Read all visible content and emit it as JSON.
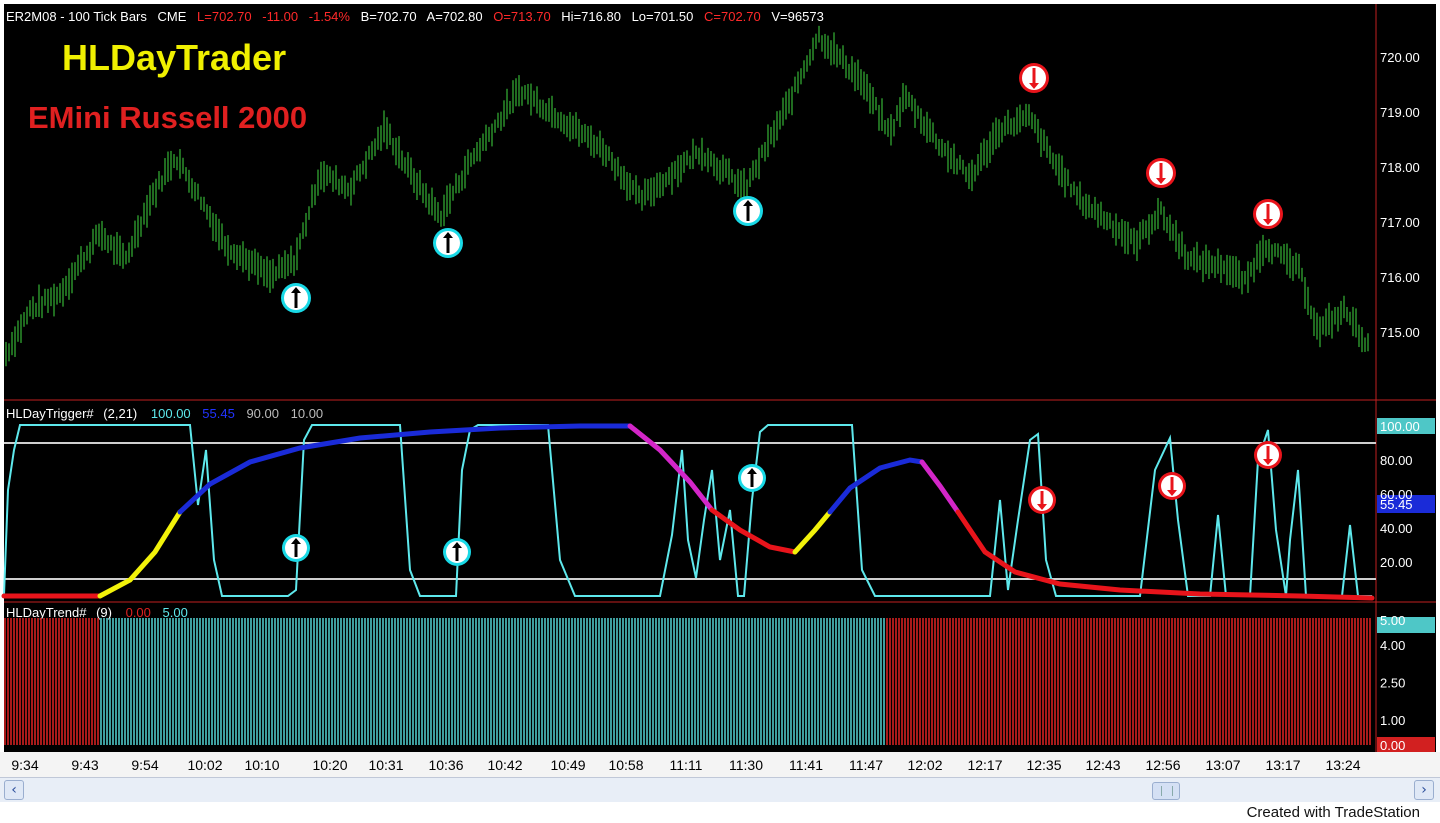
{
  "header": {
    "symbol": "ER2M08 - 100 Tick Bars",
    "exchange": "CME",
    "last": "L=702.70",
    "net_change": "-11.00",
    "pct_change": "-1.54%",
    "bid": "B=702.70",
    "ask": "A=702.80",
    "open": "O=713.70",
    "high": "Hi=716.80",
    "low": "Lo=701.50",
    "close": "C=702.70",
    "volume": "V=96573"
  },
  "titles": {
    "main": "HLDayTrader",
    "sub": "EMini Russell 2000"
  },
  "price_axis": {
    "labels": [
      "720.00",
      "719.00",
      "718.00",
      "717.00",
      "716.00",
      "715.00"
    ],
    "values": [
      720,
      719,
      718,
      717,
      716,
      715
    ]
  },
  "trigger_panel": {
    "name": "HLDayTrigger#",
    "params": "(2,21)",
    "v1": "100.00",
    "v2": "55.45",
    "v3": "90.00",
    "v4": "10.00",
    "axis_labels": [
      "100.00",
      "80.00",
      "60.00",
      "40.00",
      "20.00"
    ],
    "axis_values": [
      100,
      80,
      60,
      40,
      20
    ],
    "current_tag": "55.45"
  },
  "trend_panel": {
    "name": "HLDayTrend#",
    "params": "(9)",
    "v1": "0.00",
    "v2": "5.00",
    "axis_labels": [
      "5.00",
      "4.00",
      "2.50",
      "1.00",
      "0.00"
    ],
    "axis_values": [
      5,
      4,
      2.5,
      1,
      0
    ]
  },
  "time_axis": [
    "9:34",
    "9:43",
    "9:54",
    "10:02",
    "10:10",
    "10:20",
    "10:31",
    "10:36",
    "10:42",
    "10:49",
    "10:58",
    "11:11",
    "11:30",
    "11:41",
    "11:47",
    "12:02",
    "12:17",
    "12:35",
    "12:43",
    "12:56",
    "13:07",
    "13:17",
    "13:24"
  ],
  "signals": {
    "buy_icon": "up-arrow-circle-icon",
    "sell_icon": "down-arrow-circle-icon",
    "buy_color": "#19d9e6",
    "sell_color": "#e8141b"
  },
  "colors": {
    "background": "#000000",
    "bars": "#2e9a2e",
    "trigger_line": "#5ee8ec",
    "trend_up": "#4ec7c7",
    "trend_down": "#d22020",
    "title_main": "#f0f000",
    "title_sub": "#e02020"
  },
  "scrollbar": {
    "left_icon": "chevron-left-icon",
    "right_icon": "chevron-right-icon",
    "left_glyph": "‹",
    "right_glyph": "›"
  },
  "footer": {
    "credit": "Created with TradeStation"
  }
}
